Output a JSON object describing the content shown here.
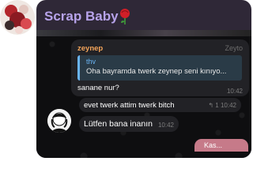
{
  "header": {
    "title": "Scrap Baby"
  },
  "messages": [
    {
      "sender": "zeynep",
      "sender_right": "Zeyto",
      "reply_author": "thv",
      "reply_text": "Oha bayramda twerk zeynep seni kınıyo...",
      "text": "sanane nur?",
      "time": "10:42"
    },
    {
      "text": "evet twerk attim twerk bitch",
      "reply_count": "1",
      "time": "10:42"
    },
    {
      "text": "Lütfen bana inanın",
      "time": "10:42"
    }
  ],
  "bottom_pill": {
    "label": "Kas..."
  },
  "colors": {
    "title": "#b7a3ea",
    "sender": "#f5a55a",
    "quote_author": "#6cb6f5",
    "pill": "#c67a89"
  }
}
